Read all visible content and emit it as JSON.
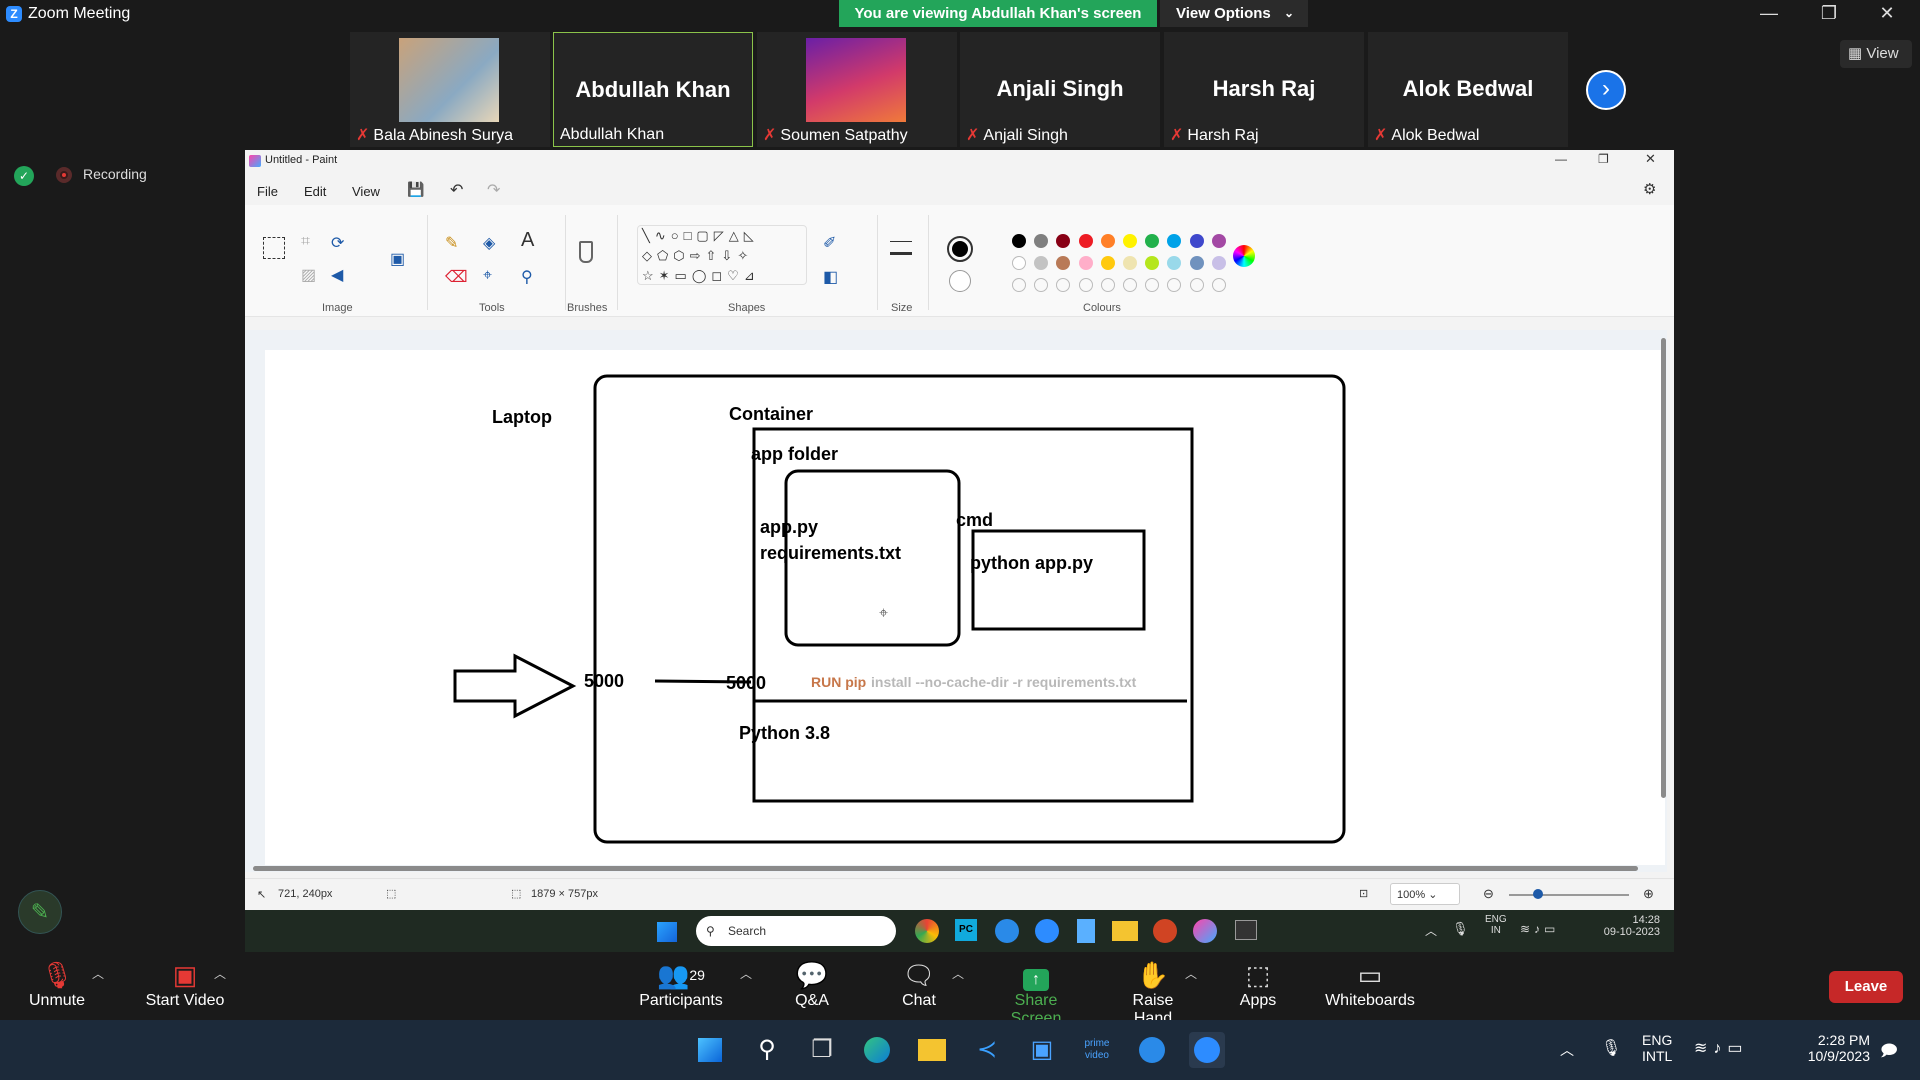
{
  "zoom": {
    "window_title": "Zoom Meeting",
    "viewing_banner": "You are viewing Abdullah Khan's screen",
    "view_options": "View Options",
    "view_button": "View",
    "recording": "Recording",
    "participants": [
      {
        "name": "Bala Abinesh Surya",
        "display": "",
        "muted": true
      },
      {
        "name": "Abdullah Khan",
        "display": "Abdullah Khan",
        "muted": false
      },
      {
        "name": "Soumen Satpathy",
        "display": "",
        "muted": true
      },
      {
        "name": "Anjali Singh",
        "display": "Anjali Singh",
        "muted": true
      },
      {
        "name": "Harsh Raj",
        "display": "Harsh Raj",
        "muted": true
      },
      {
        "name": "Alok Bedwal",
        "display": "Alok Bedwal",
        "muted": true
      }
    ],
    "toolbar": {
      "unmute": "Unmute",
      "start_video": "Start Video",
      "participants": "Participants",
      "participants_count": "29",
      "qa": "Q&A",
      "chat": "Chat",
      "share_screen": "Share Screen",
      "raise_hand": "Raise Hand",
      "apps": "Apps",
      "whiteboards": "Whiteboards",
      "leave": "Leave"
    }
  },
  "paint": {
    "title": "Untitled - Paint",
    "menu": [
      "File",
      "Edit",
      "View"
    ],
    "groups": [
      "Image",
      "Tools",
      "Brushes",
      "Shapes",
      "Size",
      "Colours"
    ],
    "colors_row1": [
      "#000000",
      "#7f7f7f",
      "#880015",
      "#ed1c24",
      "#ff7f27",
      "#fff200",
      "#22b14c",
      "#00a2e8",
      "#3f48cc",
      "#a349a4"
    ],
    "colors_row2": [
      "#ffffff",
      "#c3c3c3",
      "#b97a57",
      "#ffaec9",
      "#ffc90e",
      "#efe4b0",
      "#b5e61d",
      "#99d9ea",
      "#7092be",
      "#c8bfe7"
    ],
    "status": {
      "cursor": "721, 240px",
      "size": "1879 × 757px",
      "zoom": "100%"
    },
    "drawing": {
      "laptop": "Laptop",
      "container": "Container",
      "app_folder": "app folder",
      "file1": "app.py",
      "file2": "requirements.txt",
      "cmd": "cmd",
      "cmd_text": "python app.py",
      "port_left": "5000",
      "port_right": "5000",
      "run_kw": "RUN pip",
      "run_rest": "install --no-cache-dir -r requirements.txt",
      "base": "Python 3.8"
    },
    "inner_taskbar": {
      "search": "Search",
      "lang1": "ENG",
      "lang2": "IN",
      "time": "14:28",
      "date": "09-10-2023"
    }
  },
  "windows": {
    "lang1": "ENG",
    "lang2": "INTL",
    "time": "2:28 PM",
    "date": "10/9/2023"
  }
}
